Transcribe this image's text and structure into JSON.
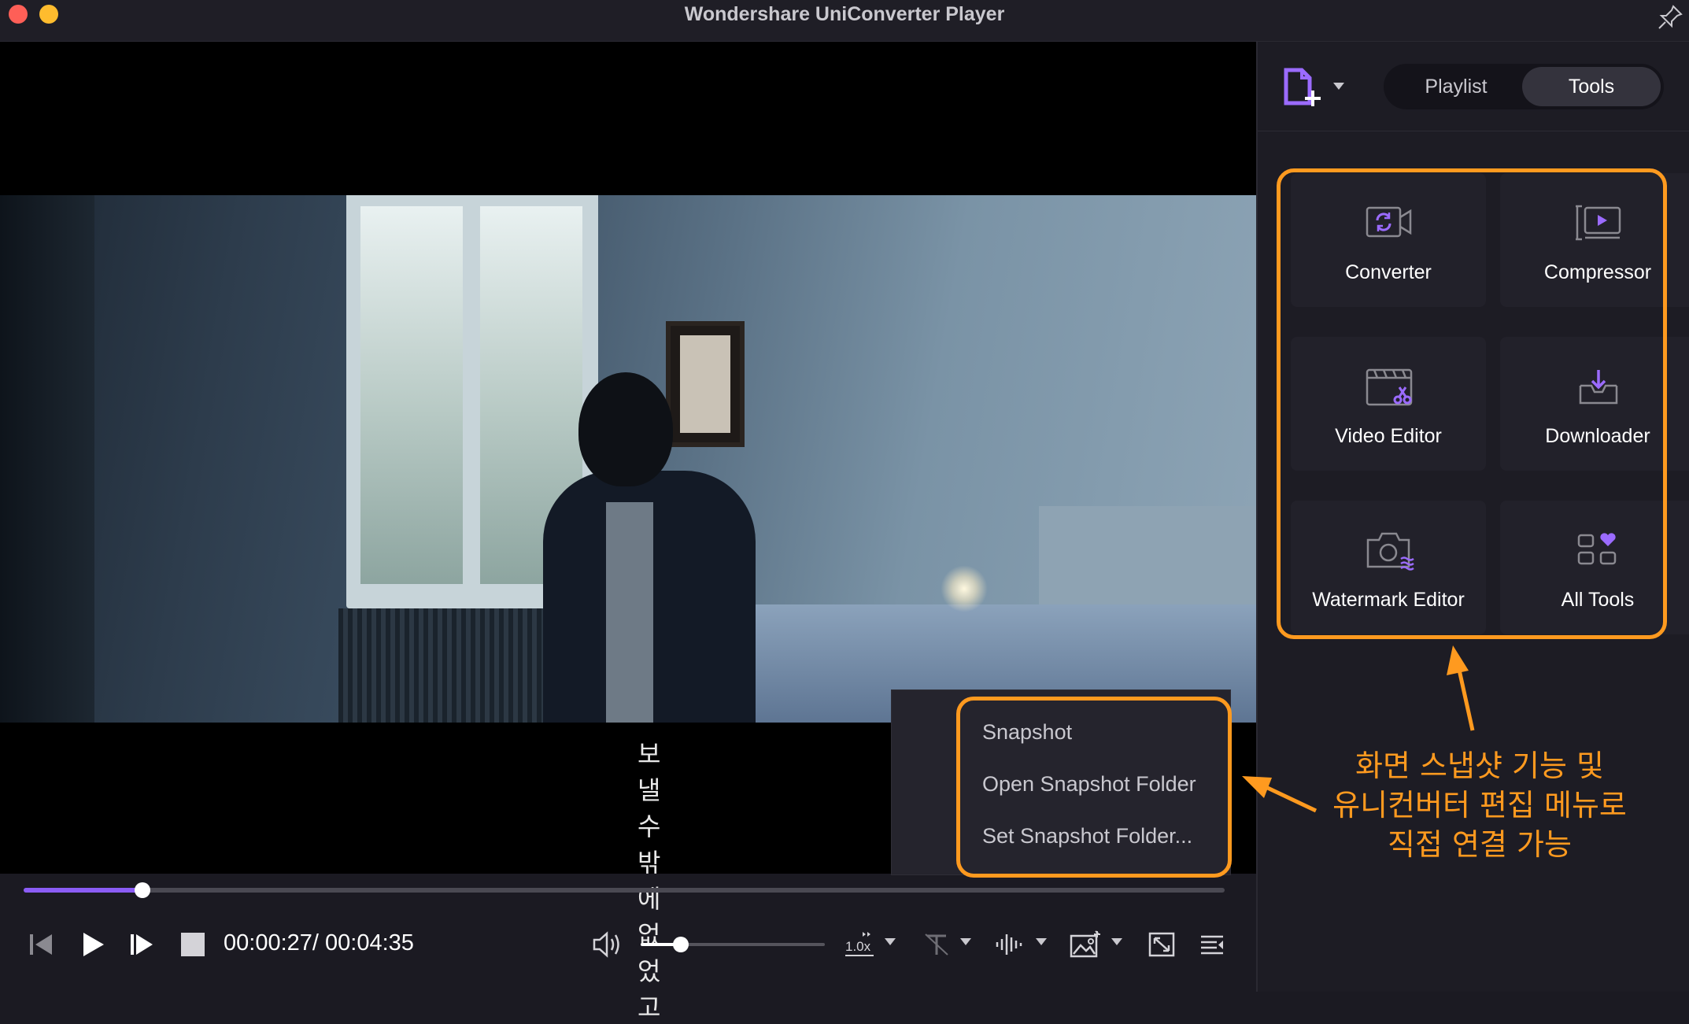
{
  "window": {
    "title": "Wondershare UniConverter Player"
  },
  "video": {
    "subtitle": "보낼 수밖에 없었고"
  },
  "snapshot_menu": {
    "items": [
      "Snapshot",
      "Open Snapshot Folder",
      "Set Snapshot Folder..."
    ]
  },
  "playback": {
    "current_time": "00:00:27",
    "separator": "/",
    "total_time": "00:04:35",
    "progress_fraction": 0.0989,
    "volume_fraction": 0.22,
    "speed_label": "1.0x"
  },
  "sidebar": {
    "tabs": [
      {
        "label": "Playlist",
        "active": false
      },
      {
        "label": "Tools",
        "active": true
      }
    ],
    "tools": [
      {
        "label": "Converter",
        "icon": "converter-icon"
      },
      {
        "label": "Compressor",
        "icon": "compressor-icon"
      },
      {
        "label": "Video Editor",
        "icon": "video-editor-icon"
      },
      {
        "label": "Downloader",
        "icon": "downloader-icon"
      },
      {
        "label": "Watermark Editor",
        "icon": "watermark-editor-icon"
      },
      {
        "label": "All Tools",
        "icon": "all-tools-icon"
      }
    ]
  },
  "annotation": {
    "lines": [
      "화면 스냅샷 기능 및",
      "유니컨버터 편집 메뉴로",
      "직접 연결 가능"
    ]
  },
  "colors": {
    "accent": "#8b5cf6",
    "highlight": "#ff9a1f",
    "background": "#1d1c24"
  }
}
